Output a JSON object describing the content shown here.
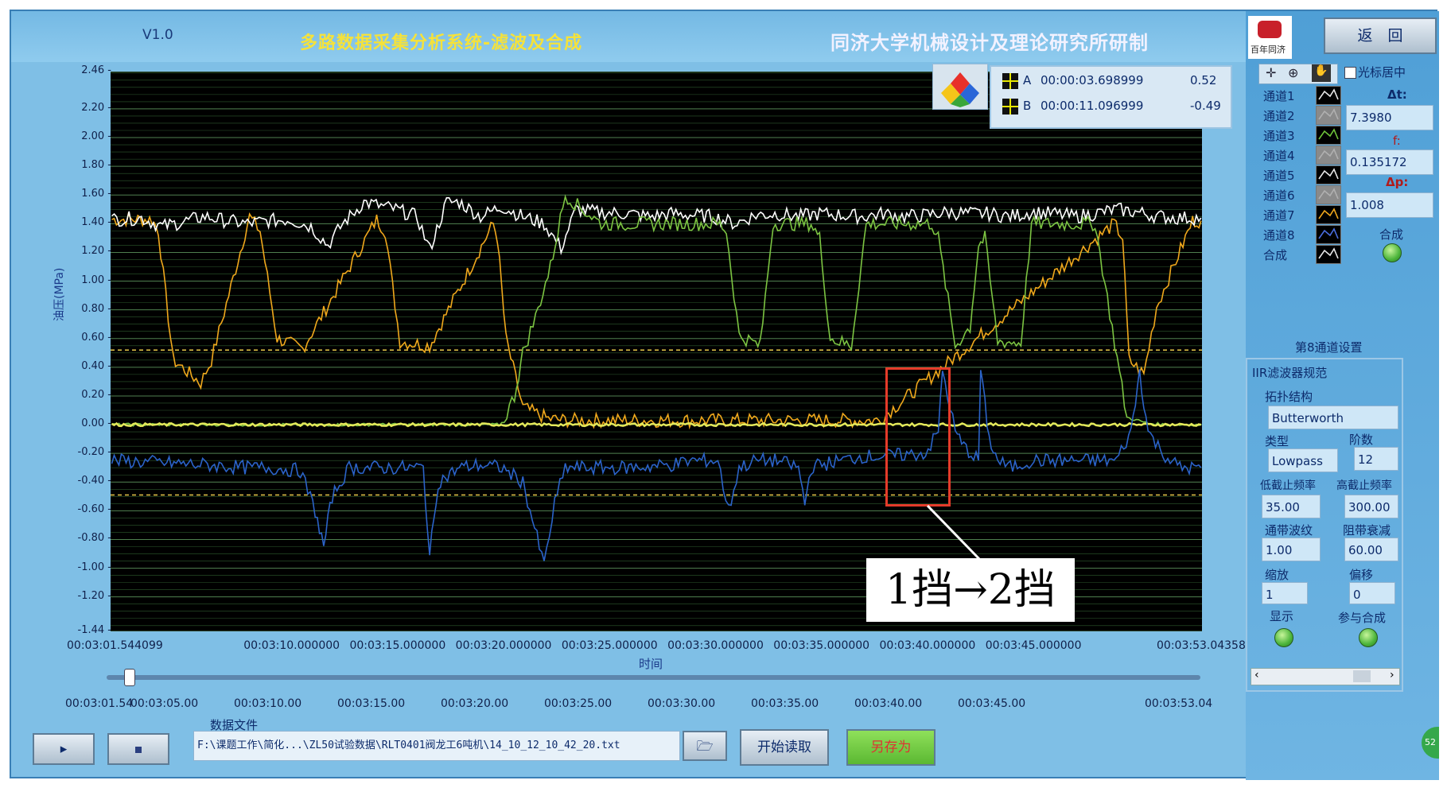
{
  "header": {
    "version": "V1.0",
    "title": "多路数据采集分析系统-滤波及合成",
    "institution": "同济大学机械设计及理论研究所研制"
  },
  "return_button": "返　回",
  "logo_text": "百年同济",
  "cursor_center_label": "光标居中",
  "delta_t_label": "Δt:",
  "delta_t": "7.3980",
  "f_label": "f:",
  "f_value": "0.135172",
  "delta_p_label": "Δp:",
  "delta_p": "1.008",
  "combine_label": "合成",
  "cursors": [
    {
      "name": "A",
      "time": "00:00:03.698999",
      "value": "0.52"
    },
    {
      "name": "B",
      "time": "00:00:11.096999",
      "value": "-0.49"
    }
  ],
  "channels": [
    "通道1",
    "通道2",
    "通道3",
    "通道4",
    "通道5",
    "通道6",
    "通道7",
    "通道8",
    "合成"
  ],
  "channel8_settings": "第8通道设置",
  "iir_spec": "IIR滤波器规范",
  "topology_label": "拓扑结构",
  "topology": "Butterworth",
  "type_label": "类型",
  "type": "Lowpass",
  "order_label": "阶数",
  "order": "12",
  "low_cut_label": "低截止频率",
  "low_cut": "35.00",
  "high_cut_label": "高截止频率",
  "high_cut": "300.00",
  "ripple_label": "通带波纹",
  "ripple": "1.00",
  "atten_label": "阻带衰减",
  "atten": "60.00",
  "scale_label": "缩放",
  "scale": "1",
  "offset_label": "偏移",
  "offset": "0",
  "display_label": "显示",
  "join_label": "参与合成",
  "data_file_label": "数据文件",
  "file_path": "F:\\课题工作\\简化...\\ZL50试验数据\\RLT0401阀龙工6吨机\\14_10_12_10_42_20.txt",
  "start_read": "开始读取",
  "save_as": "另存为",
  "annotation": "1挡→2挡",
  "slider_ticks": [
    "00:03:01.54",
    "00:03:05.00",
    "00:03:10.00",
    "00:03:15.00",
    "00:03:20.00",
    "00:03:25.00",
    "00:03:30.00",
    "00:03:35.00",
    "00:03:40.00",
    "00:03:45.00",
    "00:03:53.04"
  ],
  "corner_badge": "52",
  "chart_data": {
    "type": "line",
    "title": "",
    "xlabel": "时间",
    "ylabel": "油压(MPa)",
    "ylim": [
      -1.44,
      2.46
    ],
    "xlim": [
      181.544099,
      233.04358
    ],
    "y_ticks": [
      "2.46",
      "2.20",
      "2.00",
      "1.80",
      "1.60",
      "1.40",
      "1.20",
      "1.00",
      "0.80",
      "0.60",
      "0.40",
      "0.20",
      "0.00",
      "-0.20",
      "-0.40",
      "-0.60",
      "-0.80",
      "-1.00",
      "-1.20",
      "-1.44"
    ],
    "y_tick_values": [
      2.46,
      2.2,
      2.0,
      1.8,
      1.6,
      1.4,
      1.2,
      1.0,
      0.8,
      0.6,
      0.4,
      0.2,
      0.0,
      -0.2,
      -0.4,
      -0.6,
      -0.8,
      -1.0,
      -1.2,
      -1.44
    ],
    "x_ticks": [
      "00:03:01.544099",
      "00:03:10.000000",
      "00:03:15.000000",
      "00:03:20.000000",
      "00:03:25.000000",
      "00:03:30.000000",
      "00:03:35.000000",
      "00:03:40.000000",
      "00:03:45.000000",
      "00:03:53.04358"
    ],
    "x_tick_values": [
      181.544099,
      190,
      195,
      200,
      205,
      210,
      215,
      220,
      225,
      233.04358
    ],
    "cursor_lines": [
      0.52,
      -0.49
    ],
    "series": [
      {
        "color": "#f0a81c",
        "x": [
          181.6,
          183.5,
          183.8,
          184.5,
          185.8,
          186.3,
          186.9,
          188.1,
          188.6,
          189.4,
          190.6,
          191.6,
          194.1,
          194.5,
          195.2,
          196.6,
          199.6,
          199.8,
          200.2,
          201,
          202.2,
          203.1,
          217,
          217.8,
          228.9,
          229.3,
          229.6,
          230.3,
          230.9,
          232.6,
          233
        ],
        "y": [
          1.43,
          1.43,
          1.35,
          0.45,
          0.29,
          0.45,
          0.78,
          1.45,
          1.35,
          0.6,
          0.53,
          0.78,
          1.43,
          1.35,
          0.58,
          0.55,
          1.4,
          1.3,
          0.6,
          0.12,
          0.04,
          0.03,
          0.03,
          0.03,
          1.4,
          1.3,
          0.45,
          0.35,
          0.82,
          1.42,
          1.42
        ]
      },
      {
        "color": "#ffffff",
        "x": [
          181.6,
          183,
          184,
          186,
          187,
          188,
          189,
          190,
          191,
          191.8,
          192.5,
          193.5,
          195,
          196,
          196.6,
          197.4,
          198,
          199,
          200,
          201,
          202,
          202.8,
          203.5,
          204.5,
          206,
          207,
          208,
          209,
          210,
          211,
          212,
          213,
          214,
          215,
          216,
          217,
          218,
          219,
          220,
          221,
          222,
          223,
          224,
          225,
          226,
          227,
          228,
          229,
          230,
          231,
          232,
          233
        ],
        "y": [
          1.43,
          1.44,
          1.38,
          1.45,
          1.42,
          1.4,
          1.42,
          1.43,
          1.38,
          1.25,
          1.4,
          1.55,
          1.5,
          1.45,
          1.22,
          1.55,
          1.55,
          1.45,
          1.52,
          1.45,
          1.4,
          1.23,
          1.5,
          1.48,
          1.47,
          1.45,
          1.47,
          1.46,
          1.45,
          1.4,
          1.46,
          1.47,
          1.45,
          1.47,
          1.46,
          1.45,
          1.47,
          1.45,
          1.46,
          1.48,
          1.47,
          1.47,
          1.45,
          1.48,
          1.47,
          1.45,
          1.47,
          1.5,
          1.48,
          1.45,
          1.44,
          1.44
        ]
      },
      {
        "color": "#7cc442",
        "x": [
          181.6,
          199,
          200,
          200.6,
          201,
          201.6,
          202.3,
          203,
          203.8,
          204.7,
          205.5,
          210.3,
          210.6,
          211.2,
          212.2,
          212.8,
          214.6,
          215,
          215.5,
          216.5,
          217.2,
          220.3,
          220.6,
          221.4,
          222.1,
          222.5,
          222.8,
          223.4,
          224.5,
          225,
          227,
          228,
          229.5,
          230.5,
          231.3,
          233
        ],
        "y": [
          0.0,
          0.0,
          0.0,
          0.2,
          0.5,
          0.75,
          1.1,
          1.6,
          1.5,
          1.4,
          1.4,
          1.4,
          1.35,
          0.62,
          0.55,
          1.4,
          1.4,
          1.3,
          0.6,
          0.55,
          1.4,
          1.4,
          1.3,
          0.55,
          0.68,
          1.25,
          1.3,
          0.58,
          0.57,
          1.4,
          1.4,
          1.4,
          0.05,
          0.01,
          0.0,
          0.0
        ]
      },
      {
        "color": "#e4e85a",
        "x": [
          181.6,
          233
        ],
        "y": [
          0.0,
          0.0
        ]
      },
      {
        "color": "#2b63c9",
        "x": [
          181.6,
          186,
          188,
          189,
          190.5,
          191.2,
          191.6,
          192,
          192.8,
          194,
          195,
          196.3,
          196.6,
          197,
          198,
          199,
          200,
          201,
          202,
          202.5,
          203,
          204,
          206,
          208,
          209,
          210.2,
          210.7,
          211.2,
          212,
          213,
          214,
          214.3,
          214.6,
          215,
          216,
          217,
          218,
          220,
          220.6,
          220.8,
          221.4,
          221.8,
          222.5,
          222.6,
          223,
          223.4,
          224,
          225,
          227,
          228,
          229,
          229.7,
          230.1,
          230.5,
          231.2,
          232,
          233
        ],
        "y": [
          -0.25,
          -0.28,
          -0.3,
          -0.3,
          -0.32,
          -0.6,
          -0.85,
          -0.5,
          -0.3,
          -0.3,
          -0.3,
          -0.3,
          -0.92,
          -0.4,
          -0.3,
          -0.28,
          -0.3,
          -0.4,
          -0.98,
          -0.55,
          -0.3,
          -0.3,
          -0.3,
          -0.28,
          -0.25,
          -0.25,
          -0.6,
          -0.3,
          -0.25,
          -0.25,
          -0.3,
          -0.55,
          -0.3,
          -0.28,
          -0.25,
          -0.22,
          -0.22,
          -0.2,
          -0.05,
          0.38,
          -0.05,
          -0.15,
          -0.25,
          0.38,
          -0.1,
          -0.25,
          -0.3,
          -0.25,
          -0.25,
          -0.25,
          -0.25,
          -0.05,
          0.37,
          -0.05,
          -0.2,
          -0.3,
          -0.3
        ]
      }
    ]
  }
}
